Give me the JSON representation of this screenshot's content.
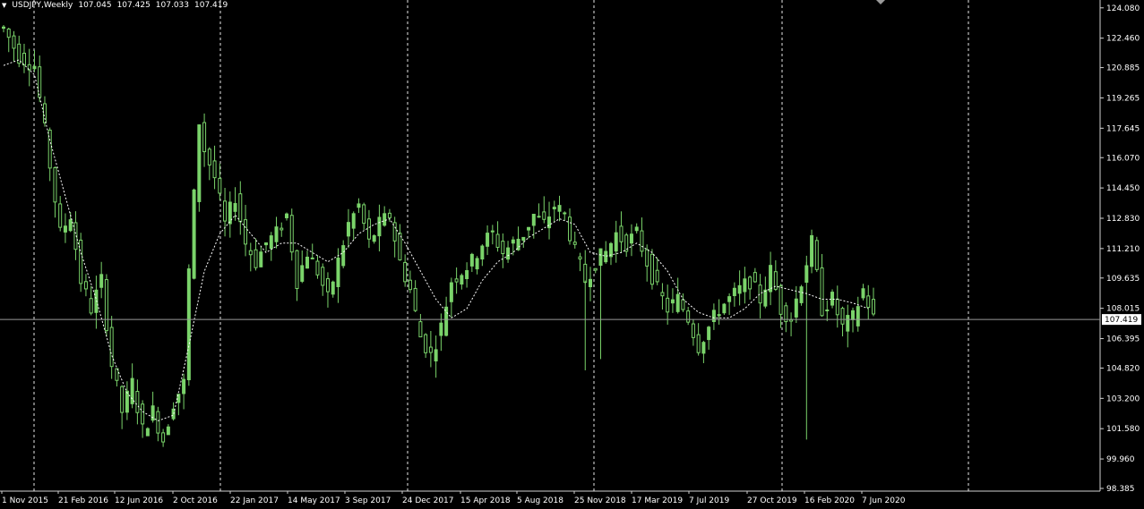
{
  "header": {
    "symbol": "USDJPY,Weekly",
    "open": "107.045",
    "high": "107.425",
    "low": "107.033",
    "close": "107.419"
  },
  "colors": {
    "background": "#000000",
    "candle": "#7ad36a",
    "moving_average": "#ffffff",
    "grid": "#ffffff",
    "price_line": "#9a9a9a",
    "text": "#ffffff"
  },
  "chart_data": {
    "type": "candlestick",
    "symbol": "USDJPY",
    "timeframe": "Weekly",
    "current_price": "107.419",
    "ylim": [
      98.385,
      124.5
    ],
    "y_ticks": [
      "124.080",
      "122.460",
      "120.885",
      "119.265",
      "117.645",
      "116.070",
      "114.450",
      "112.830",
      "111.210",
      "109.635",
      "108.015",
      "106.395",
      "104.820",
      "103.200",
      "101.580",
      "99.960",
      "98.385"
    ],
    "x_ticks": [
      "1 Nov 2015",
      "21 Feb 2016",
      "12 Jun 2016",
      "2 Oct 2016",
      "22 Jan 2017",
      "14 May 2017",
      "3 Sep 2017",
      "24 Dec 2017",
      "15 Apr 2018",
      "5 Aug 2018",
      "25 Nov 2018",
      "17 Mar 2019",
      "7 Jul 2019",
      "27 Oct 2019",
      "16 Feb 2020",
      "7 Jun 2020"
    ],
    "grid": "vertical-dashed",
    "close_path": [
      [
        0,
        123.0
      ],
      [
        3,
        121.5
      ],
      [
        6,
        121.0
      ],
      [
        8,
        117.5
      ],
      [
        11,
        112.0
      ],
      [
        13,
        113.0
      ],
      [
        15,
        109.5
      ],
      [
        17,
        108.0
      ],
      [
        19,
        109.5
      ],
      [
        21,
        105.0
      ],
      [
        23,
        102.5
      ],
      [
        25,
        104.0
      ],
      [
        27,
        101.5
      ],
      [
        29,
        102.5
      ],
      [
        31,
        101.0
      ],
      [
        33,
        103.0
      ],
      [
        35,
        104.0
      ],
      [
        36,
        110.0
      ],
      [
        37,
        114.0
      ],
      [
        38,
        118.0
      ],
      [
        39,
        116.5
      ],
      [
        41,
        115.0
      ],
      [
        43,
        112.5
      ],
      [
        45,
        114.0
      ],
      [
        47,
        111.5
      ],
      [
        49,
        110.5
      ],
      [
        51,
        111.5
      ],
      [
        53,
        112.0
      ],
      [
        55,
        113.0
      ],
      [
        57,
        109.5
      ],
      [
        59,
        111.0
      ],
      [
        61,
        110.0
      ],
      [
        63,
        108.5
      ],
      [
        65,
        110.5
      ],
      [
        67,
        112.5
      ],
      [
        69,
        113.5
      ],
      [
        71,
        111.5
      ],
      [
        73,
        112.5
      ],
      [
        75,
        113.0
      ],
      [
        77,
        110.5
      ],
      [
        79,
        109.0
      ],
      [
        81,
        106.5
      ],
      [
        83,
        105.5
      ],
      [
        85,
        107.0
      ],
      [
        87,
        109.5
      ],
      [
        89,
        110.0
      ],
      [
        91,
        110.5
      ],
      [
        93,
        111.5
      ],
      [
        95,
        112.0
      ],
      [
        97,
        111.0
      ],
      [
        99,
        111.5
      ],
      [
        101,
        112.0
      ],
      [
        103,
        113.0
      ],
      [
        105,
        112.5
      ],
      [
        107,
        113.5
      ],
      [
        109,
        113.0
      ],
      [
        111,
        111.0
      ],
      [
        113,
        109.5
      ],
      [
        115,
        110.5
      ],
      [
        117,
        111.0
      ],
      [
        119,
        112.0
      ],
      [
        121,
        111.5
      ],
      [
        123,
        112.0
      ],
      [
        125,
        110.5
      ],
      [
        127,
        109.0
      ],
      [
        129,
        108.0
      ],
      [
        131,
        108.5
      ],
      [
        133,
        107.5
      ],
      [
        135,
        106.0
      ],
      [
        137,
        107.0
      ],
      [
        139,
        108.0
      ],
      [
        141,
        108.5
      ],
      [
        143,
        109.0
      ],
      [
        145,
        109.5
      ],
      [
        147,
        108.5
      ],
      [
        149,
        110.0
      ],
      [
        151,
        108.0
      ],
      [
        153,
        107.5
      ],
      [
        155,
        109.5
      ],
      [
        157,
        111.5
      ],
      [
        159,
        108.0
      ],
      [
        161,
        108.5
      ],
      [
        163,
        107.0
      ],
      [
        165,
        107.5
      ],
      [
        167,
        109.0
      ],
      [
        169,
        107.5
      ]
    ],
    "ma_path": [
      [
        0,
        121.0
      ],
      [
        3,
        121.3
      ],
      [
        6,
        120.5
      ],
      [
        9,
        117.0
      ],
      [
        12,
        114.0
      ],
      [
        15,
        111.0
      ],
      [
        18,
        108.5
      ],
      [
        21,
        105.5
      ],
      [
        24,
        103.5
      ],
      [
        27,
        102.5
      ],
      [
        30,
        102.0
      ],
      [
        33,
        102.3
      ],
      [
        36,
        106.0
      ],
      [
        39,
        110.0
      ],
      [
        42,
        112.0
      ],
      [
        45,
        113.0
      ],
      [
        48,
        112.0
      ],
      [
        51,
        111.0
      ],
      [
        54,
        111.5
      ],
      [
        57,
        111.5
      ],
      [
        60,
        111.0
      ],
      [
        63,
        110.5
      ],
      [
        66,
        111.0
      ],
      [
        69,
        112.0
      ],
      [
        72,
        112.5
      ],
      [
        75,
        112.8
      ],
      [
        78,
        111.5
      ],
      [
        81,
        110.0
      ],
      [
        84,
        108.5
      ],
      [
        87,
        107.5
      ],
      [
        90,
        108.0
      ],
      [
        93,
        109.5
      ],
      [
        96,
        110.5
      ],
      [
        99,
        111.0
      ],
      [
        102,
        111.8
      ],
      [
        105,
        112.3
      ],
      [
        108,
        112.8
      ],
      [
        111,
        112.5
      ],
      [
        114,
        111.0
      ],
      [
        117,
        110.8
      ],
      [
        120,
        111.0
      ],
      [
        123,
        111.5
      ],
      [
        126,
        111.0
      ],
      [
        129,
        110.0
      ],
      [
        132,
        108.5
      ],
      [
        135,
        107.8
      ],
      [
        138,
        107.5
      ],
      [
        141,
        107.5
      ],
      [
        144,
        108.0
      ],
      [
        147,
        108.8
      ],
      [
        150,
        109.2
      ],
      [
        153,
        109.0
      ],
      [
        156,
        108.8
      ],
      [
        159,
        108.5
      ],
      [
        162,
        108.5
      ],
      [
        165,
        108.3
      ],
      [
        168,
        108.0
      ]
    ],
    "spikes": [
      [
        113,
        104.7
      ],
      [
        156,
        101.0
      ],
      [
        143,
        109.0
      ],
      [
        116,
        105.3
      ]
    ]
  }
}
